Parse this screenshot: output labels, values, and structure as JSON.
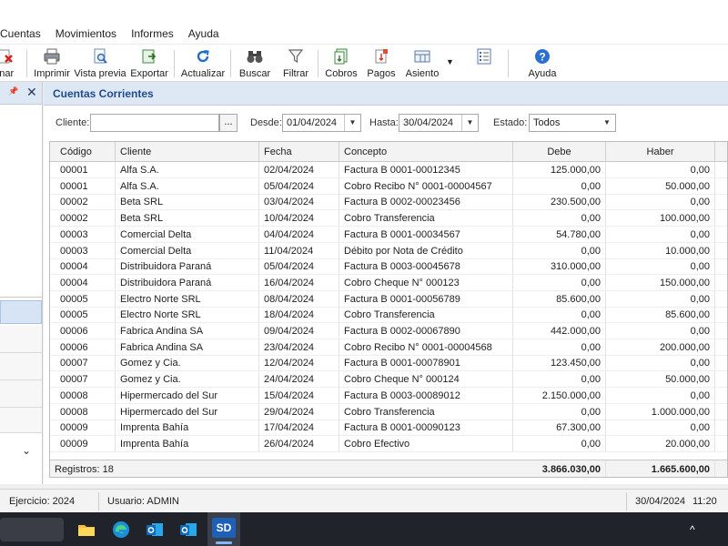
{
  "menu": [
    "Cuentas",
    "Movimientos",
    "Informes",
    "Ayuda"
  ],
  "toolbar": {
    "eliminar": "inar",
    "imprimir": "Imprimir",
    "vista_previa": "Vista previa",
    "exportar": "Exportar",
    "actualizar": "Actualizar",
    "buscar": "Buscar",
    "filtrar": "Filtrar",
    "cobros": "Cobros",
    "pagos": "Pagos",
    "asiento": "Asiento",
    "ayuda": "Ayuda"
  },
  "left_panel": {
    "pin": "📌",
    "close": "✕",
    "chevron": "⌄"
  },
  "panel_title": "Cuentas Corrientes",
  "filters": {
    "cliente_label": "Cliente:",
    "cliente_value": "",
    "cliente_btn": "...",
    "desde_label": "Desde:",
    "desde_value": "01/04/2024",
    "hasta_label": "Hasta:",
    "hasta_value": "30/04/2024",
    "estado_label": "Estado:",
    "estado_value": "Todos"
  },
  "grid": {
    "columns": [
      "Código",
      "Cliente",
      "Fecha",
      "Concepto",
      "Debe",
      "Haber"
    ],
    "rows": [
      [
        "00001",
        "Alfa S.A.",
        "02/04/2024",
        "Factura B 0001-00012345",
        "125.000,00",
        "0,00"
      ],
      [
        "00001",
        "Alfa S.A.",
        "05/04/2024",
        "Cobro Recibo N° 0001-00004567",
        "0,00",
        "50.000,00"
      ],
      [
        "00002",
        "Beta SRL",
        "03/04/2024",
        "Factura B 0002-00023456",
        "230.500,00",
        "0,00"
      ],
      [
        "00002",
        "Beta SRL",
        "10/04/2024",
        "Cobro Transferencia",
        "0,00",
        "100.000,00"
      ],
      [
        "00003",
        "Comercial Delta",
        "04/04/2024",
        "Factura B 0001-00034567",
        "54.780,00",
        "0,00"
      ],
      [
        "00003",
        "Comercial Delta",
        "11/04/2024",
        "Débito por Nota de Crédito",
        "0,00",
        "10.000,00"
      ],
      [
        "00004",
        "Distribuidora Paraná",
        "05/04/2024",
        "Factura B 0003-00045678",
        "310.000,00",
        "0,00"
      ],
      [
        "00004",
        "Distribuidora Paraná",
        "16/04/2024",
        "Cobro Cheque N° 000123",
        "0,00",
        "150.000,00"
      ],
      [
        "00005",
        "Electro Norte SRL",
        "08/04/2024",
        "Factura B 0001-00056789",
        "85.600,00",
        "0,00"
      ],
      [
        "00005",
        "Electro Norte SRL",
        "18/04/2024",
        "Cobro Transferencia",
        "0,00",
        "85.600,00"
      ],
      [
        "00006",
        "Fabrica Andina SA",
        "09/04/2024",
        "Factura B 0002-00067890",
        "442.000,00",
        "0,00"
      ],
      [
        "00006",
        "Fabrica Andina SA",
        "23/04/2024",
        "Cobro Recibo N° 0001-00004568",
        "0,00",
        "200.000,00"
      ],
      [
        "00007",
        "Gomez y Cia.",
        "12/04/2024",
        "Factura B 0001-00078901",
        "123.450,00",
        "0,00"
      ],
      [
        "00007",
        "Gomez y Cia.",
        "24/04/2024",
        "Cobro Cheque N° 000124",
        "0,00",
        "50.000,00"
      ],
      [
        "00008",
        "Hipermercado del Sur",
        "15/04/2024",
        "Factura B 0003-00089012",
        "2.150.000,00",
        "0,00"
      ],
      [
        "00008",
        "Hipermercado del Sur",
        "29/04/2024",
        "Cobro Transferencia",
        "0,00",
        "1.000.000,00"
      ],
      [
        "00009",
        "Imprenta Bahía",
        "17/04/2024",
        "Factura B 0001-00090123",
        "67.300,00",
        "0,00"
      ],
      [
        "00009",
        "Imprenta Bahía",
        "26/04/2024",
        "Cobro Efectivo",
        "0,00",
        "20.000,00"
      ]
    ],
    "footer": {
      "registros": "Registros: 18",
      "total_debe": "3.866.030,00",
      "total_haber": "1.665.600,00"
    }
  },
  "status": {
    "ejercicio": "Ejercicio: 2024",
    "usuario": "Usuario: ADMIN",
    "fecha": "30/04/2024",
    "hora": "11:20"
  },
  "taskbar": {
    "active_app": "SD",
    "tray": "^"
  },
  "colors": {
    "accent": "#1f4b8e",
    "panel_header": "#dde8f4",
    "selection": "#d6e4f5"
  }
}
